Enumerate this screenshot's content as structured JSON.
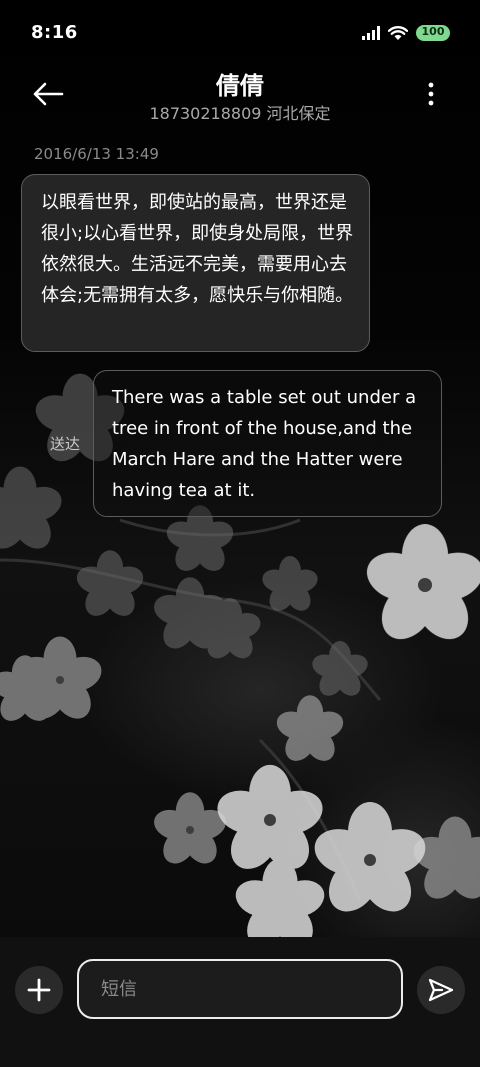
{
  "status_bar": {
    "time": "8:16",
    "battery_level": "100",
    "icons": [
      "signal-icon",
      "wifi-icon",
      "battery-icon"
    ],
    "battery_color": "#7fd98f"
  },
  "header": {
    "title": "倩倩",
    "subtitle": "18730218809 河北保定",
    "back_icon": "arrow-left-icon",
    "more_icon": "more-vertical-icon"
  },
  "conversation": {
    "timestamp": "2016/6/13 13:49",
    "messages": [
      {
        "direction": "incoming",
        "text": "以眼看世界，即使站的最高，世界还是很小;以心看世界，即使身处局限，世界依然很大。生活远不完美，需要用心去体会;无需拥有太多，愿快乐与你相随。"
      },
      {
        "direction": "outgoing",
        "status": "送达",
        "text": "There was a table set out under a tree in front of the house,and the March Hare and the Hatter were having tea at it."
      }
    ]
  },
  "composer": {
    "placeholder": "短信",
    "value": "",
    "add_icon": "plus-icon",
    "send_icon": "send-icon"
  },
  "colors": {
    "background": "#050505",
    "bubble_border": "#5c5c5c",
    "input_border": "#ececec"
  }
}
